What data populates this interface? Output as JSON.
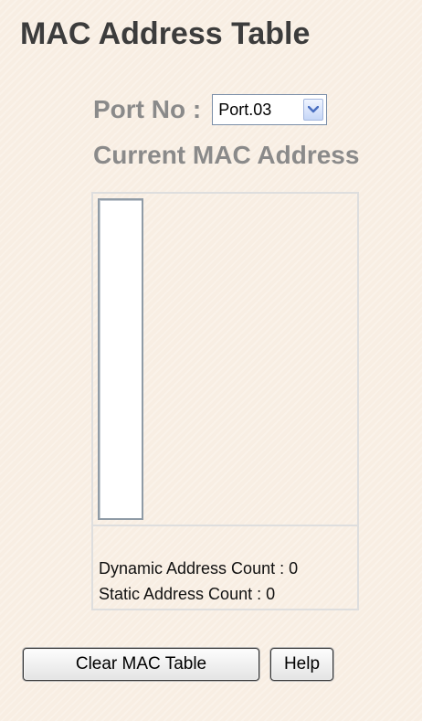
{
  "page": {
    "title": "MAC Address Table"
  },
  "port_selector": {
    "label": "Port No :",
    "selected_value": "Port.03",
    "dropdown_icon": "chevron-down-icon"
  },
  "mac_list": {
    "section_title": "Current MAC Address",
    "entries": [],
    "dynamic_count_text": "Dynamic Address Count : 0",
    "static_count_text": "Static Address Count : 0"
  },
  "actions": {
    "clear_label": "Clear MAC Table",
    "help_label": "Help"
  },
  "colors": {
    "background": "#f8eee3",
    "title_text": "#3c3c3c",
    "label_text": "#8a8a8a",
    "select_arrow": "#4a6fc0"
  }
}
